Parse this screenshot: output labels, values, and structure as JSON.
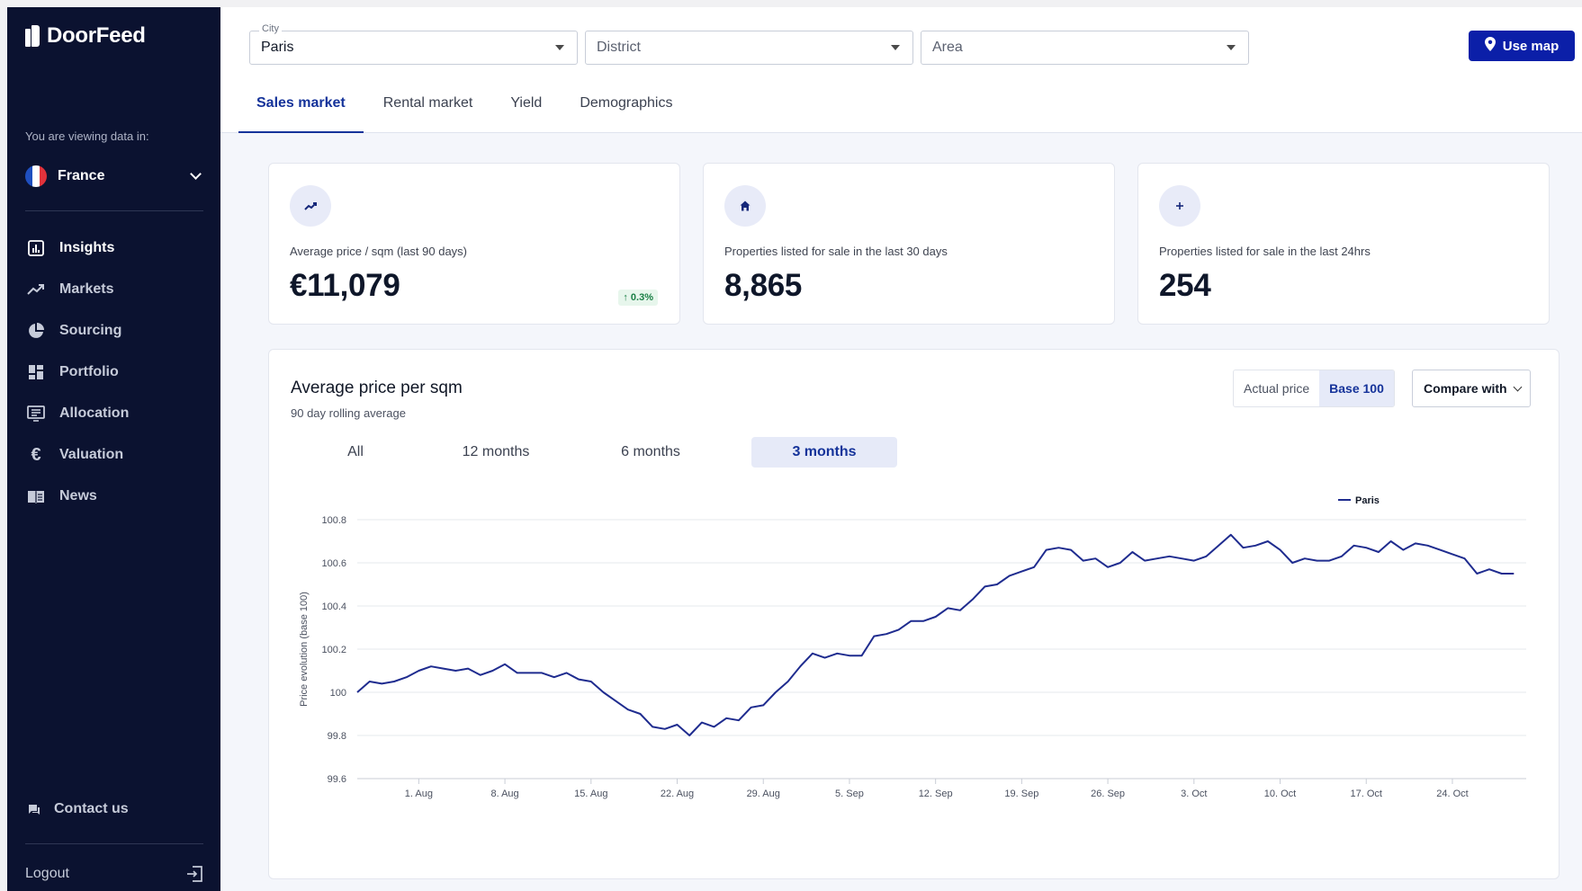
{
  "app": {
    "name": "DoorFeed",
    "viewing_label": "You are viewing data in:",
    "country": "France"
  },
  "sidebar": {
    "items": [
      {
        "label": "Insights",
        "icon": "insights-icon",
        "active": true
      },
      {
        "label": "Markets",
        "icon": "markets-icon",
        "active": false
      },
      {
        "label": "Sourcing",
        "icon": "sourcing-icon",
        "active": false
      },
      {
        "label": "Portfolio",
        "icon": "portfolio-icon",
        "active": false
      },
      {
        "label": "Allocation",
        "icon": "allocation-icon",
        "active": false
      },
      {
        "label": "Valuation",
        "icon": "valuation-icon",
        "active": false
      },
      {
        "label": "News",
        "icon": "news-icon",
        "active": false
      }
    ],
    "contact": "Contact us",
    "logout": "Logout"
  },
  "filters": {
    "city": {
      "label": "City",
      "value": "Paris"
    },
    "district": {
      "placeholder": "District"
    },
    "area": {
      "placeholder": "Area"
    }
  },
  "use_map": "Use map",
  "tabs": [
    {
      "label": "Sales market",
      "active": true
    },
    {
      "label": "Rental market",
      "active": false
    },
    {
      "label": "Yield",
      "active": false
    },
    {
      "label": "Demographics",
      "active": false
    }
  ],
  "stats": [
    {
      "label": "Average price / sqm (last 90 days)",
      "value": "€11,079",
      "change": "0.3%",
      "icon": "trend-up-icon"
    },
    {
      "label": "Properties listed for sale in the last 30 days",
      "value": "8,865",
      "icon": "home-icon"
    },
    {
      "label": "Properties listed for sale in the last 24hrs",
      "value": "254",
      "icon": "plus-icon"
    }
  ],
  "chart_panel": {
    "title": "Average price per sqm",
    "subtitle": "90 day rolling average",
    "toggle": {
      "actual": "Actual price",
      "base": "Base 100",
      "selected": "Base 100"
    },
    "compare": "Compare with",
    "ranges": [
      "All",
      "12 months",
      "6 months",
      "3 months"
    ],
    "selected_range": "3 months"
  },
  "colors": {
    "sidebar": "#0b1230",
    "accent": "#15339a",
    "button": "#0b1fa8",
    "line": "#1f2c8f",
    "positive": "#1a7f45"
  },
  "chart_data": {
    "type": "line",
    "title": "",
    "xlabel": "",
    "ylabel": "Price evolution (base 100)",
    "ylim": [
      99.6,
      100.8
    ],
    "yticks": [
      "100.8",
      "100.6",
      "100.4",
      "100.2",
      "100",
      "99.8",
      "99.6"
    ],
    "xticks": [
      {
        "date": "2023-08-01",
        "label": "1. Aug"
      },
      {
        "date": "2023-08-08",
        "label": "8. Aug"
      },
      {
        "date": "2023-08-15",
        "label": "15. Aug"
      },
      {
        "date": "2023-08-22",
        "label": "22. Aug"
      },
      {
        "date": "2023-08-29",
        "label": "29. Aug"
      },
      {
        "date": "2023-09-05",
        "label": "5. Sep"
      },
      {
        "date": "2023-09-12",
        "label": "12. Sep"
      },
      {
        "date": "2023-09-19",
        "label": "19. Sep"
      },
      {
        "date": "2023-09-26",
        "label": "26. Sep"
      },
      {
        "date": "2023-10-03",
        "label": "3. Oct"
      },
      {
        "date": "2023-10-10",
        "label": "10. Oct"
      },
      {
        "date": "2023-10-17",
        "label": "17. Oct"
      },
      {
        "date": "2023-10-24",
        "label": "24. Oct"
      }
    ],
    "grid": true,
    "legend_position": "top-right",
    "series": [
      {
        "name": "Paris",
        "points": [
          [
            "2023-07-27",
            100.0
          ],
          [
            "2023-07-28",
            100.05
          ],
          [
            "2023-07-29",
            100.04
          ],
          [
            "2023-07-30",
            100.05
          ],
          [
            "2023-07-31",
            100.07
          ],
          [
            "2023-08-01",
            100.1
          ],
          [
            "2023-08-02",
            100.12
          ],
          [
            "2023-08-03",
            100.11
          ],
          [
            "2023-08-04",
            100.1
          ],
          [
            "2023-08-05",
            100.11
          ],
          [
            "2023-08-06",
            100.08
          ],
          [
            "2023-08-07",
            100.1
          ],
          [
            "2023-08-08",
            100.13
          ],
          [
            "2023-08-09",
            100.09
          ],
          [
            "2023-08-10",
            100.09
          ],
          [
            "2023-08-11",
            100.09
          ],
          [
            "2023-08-12",
            100.07
          ],
          [
            "2023-08-13",
            100.09
          ],
          [
            "2023-08-14",
            100.06
          ],
          [
            "2023-08-15",
            100.05
          ],
          [
            "2023-08-16",
            100.0
          ],
          [
            "2023-08-17",
            99.96
          ],
          [
            "2023-08-18",
            99.92
          ],
          [
            "2023-08-19",
            99.9
          ],
          [
            "2023-08-20",
            99.84
          ],
          [
            "2023-08-21",
            99.83
          ],
          [
            "2023-08-22",
            99.85
          ],
          [
            "2023-08-23",
            99.8
          ],
          [
            "2023-08-24",
            99.86
          ],
          [
            "2023-08-25",
            99.84
          ],
          [
            "2023-08-26",
            99.88
          ],
          [
            "2023-08-27",
            99.87
          ],
          [
            "2023-08-28",
            99.93
          ],
          [
            "2023-08-29",
            99.94
          ],
          [
            "2023-08-30",
            100.0
          ],
          [
            "2023-08-31",
            100.05
          ],
          [
            "2023-09-01",
            100.12
          ],
          [
            "2023-09-02",
            100.18
          ],
          [
            "2023-09-03",
            100.16
          ],
          [
            "2023-09-04",
            100.18
          ],
          [
            "2023-09-05",
            100.17
          ],
          [
            "2023-09-06",
            100.17
          ],
          [
            "2023-09-07",
            100.26
          ],
          [
            "2023-09-08",
            100.27
          ],
          [
            "2023-09-09",
            100.29
          ],
          [
            "2023-09-10",
            100.33
          ],
          [
            "2023-09-11",
            100.33
          ],
          [
            "2023-09-12",
            100.35
          ],
          [
            "2023-09-13",
            100.39
          ],
          [
            "2023-09-14",
            100.38
          ],
          [
            "2023-09-15",
            100.43
          ],
          [
            "2023-09-16",
            100.49
          ],
          [
            "2023-09-17",
            100.5
          ],
          [
            "2023-09-18",
            100.54
          ],
          [
            "2023-09-19",
            100.56
          ],
          [
            "2023-09-20",
            100.58
          ],
          [
            "2023-09-21",
            100.66
          ],
          [
            "2023-09-22",
            100.67
          ],
          [
            "2023-09-23",
            100.66
          ],
          [
            "2023-09-24",
            100.61
          ],
          [
            "2023-09-25",
            100.62
          ],
          [
            "2023-09-26",
            100.58
          ],
          [
            "2023-09-27",
            100.6
          ],
          [
            "2023-09-28",
            100.65
          ],
          [
            "2023-09-29",
            100.61
          ],
          [
            "2023-09-30",
            100.62
          ],
          [
            "2023-10-01",
            100.63
          ],
          [
            "2023-10-02",
            100.62
          ],
          [
            "2023-10-03",
            100.61
          ],
          [
            "2023-10-04",
            100.63
          ],
          [
            "2023-10-05",
            100.68
          ],
          [
            "2023-10-06",
            100.73
          ],
          [
            "2023-10-07",
            100.67
          ],
          [
            "2023-10-08",
            100.68
          ],
          [
            "2023-10-09",
            100.7
          ],
          [
            "2023-10-10",
            100.66
          ],
          [
            "2023-10-11",
            100.6
          ],
          [
            "2023-10-12",
            100.62
          ],
          [
            "2023-10-13",
            100.61
          ],
          [
            "2023-10-14",
            100.61
          ],
          [
            "2023-10-15",
            100.63
          ],
          [
            "2023-10-16",
            100.68
          ],
          [
            "2023-10-17",
            100.67
          ],
          [
            "2023-10-18",
            100.65
          ],
          [
            "2023-10-19",
            100.7
          ],
          [
            "2023-10-20",
            100.66
          ],
          [
            "2023-10-21",
            100.69
          ],
          [
            "2023-10-22",
            100.68
          ],
          [
            "2023-10-23",
            100.66
          ],
          [
            "2023-10-24",
            100.64
          ],
          [
            "2023-10-25",
            100.62
          ],
          [
            "2023-10-26",
            100.55
          ],
          [
            "2023-10-27",
            100.57
          ],
          [
            "2023-10-28",
            100.55
          ],
          [
            "2023-10-29",
            100.55
          ]
        ]
      }
    ]
  }
}
